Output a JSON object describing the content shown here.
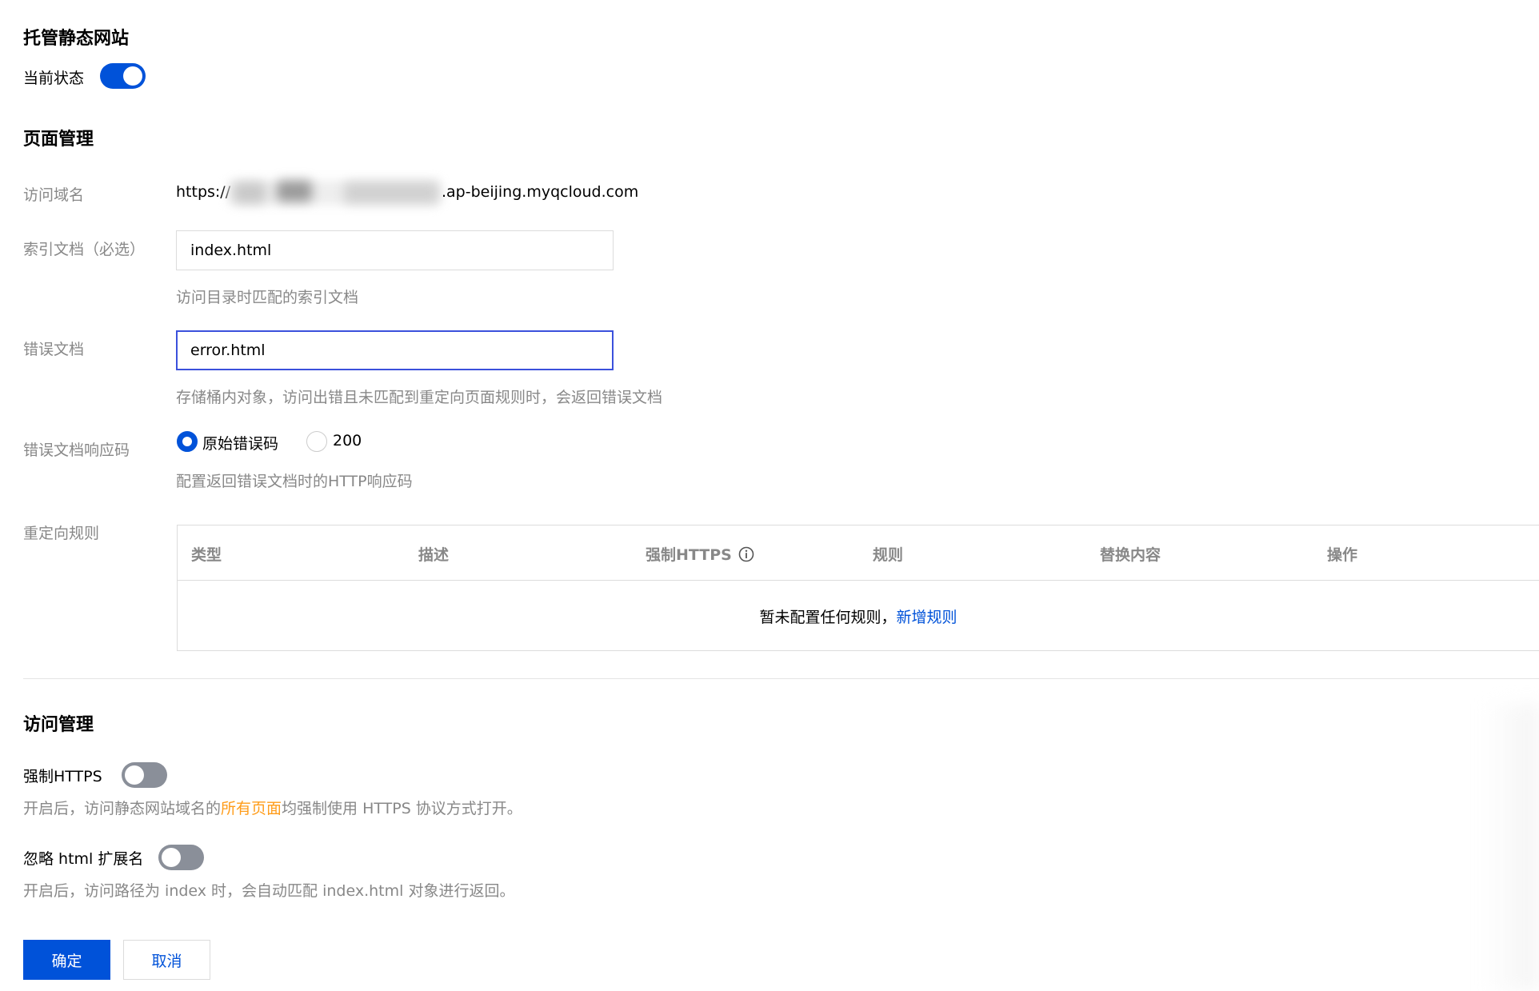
{
  "hosting": {
    "title": "托管静态网站",
    "status_label": "当前状态",
    "status_on": true
  },
  "page_management": {
    "title": "页面管理",
    "domain": {
      "label": "访问域名",
      "prefix": "https://",
      "suffix": ".ap-beijing.myqcloud.com"
    },
    "index_doc": {
      "label": "索引文档（必选）",
      "value": "index.html",
      "hint": "访问目录时匹配的索引文档"
    },
    "error_doc": {
      "label": "错误文档",
      "value": "error.html",
      "hint": "存储桶内对象，访问出错且未匹配到重定向页面规则时，会返回错误文档"
    },
    "error_code": {
      "label": "错误文档响应码",
      "options": [
        "原始错误码",
        "200"
      ],
      "selected": "原始错误码",
      "hint": "配置返回错误文档时的HTTP响应码"
    },
    "redirect": {
      "label": "重定向规则",
      "columns": [
        "类型",
        "描述",
        "强制HTTPS",
        "规则",
        "替换内容",
        "操作"
      ],
      "empty_text": "暂未配置任何规则，",
      "add_link": "新增规则"
    }
  },
  "access_management": {
    "title": "访问管理",
    "force_https": {
      "label": "强制HTTPS",
      "on": false,
      "hint_before": "开启后，访问静态网站域名的",
      "hint_highlight": "所有页面",
      "hint_after": "均强制使用 HTTPS 协议方式打开。"
    },
    "ignore_ext": {
      "label": "忽略 html 扩展名",
      "on": false,
      "hint": "开启后，访问路径为 index 时，会自动匹配 index.html 对象进行返回。"
    }
  },
  "actions": {
    "confirm": "确定",
    "cancel": "取消"
  },
  "colors": {
    "primary": "#0052d9",
    "highlight": "#ff9c19",
    "toggle_off": "#8a8f99",
    "focus_border": "#3b51dc"
  }
}
